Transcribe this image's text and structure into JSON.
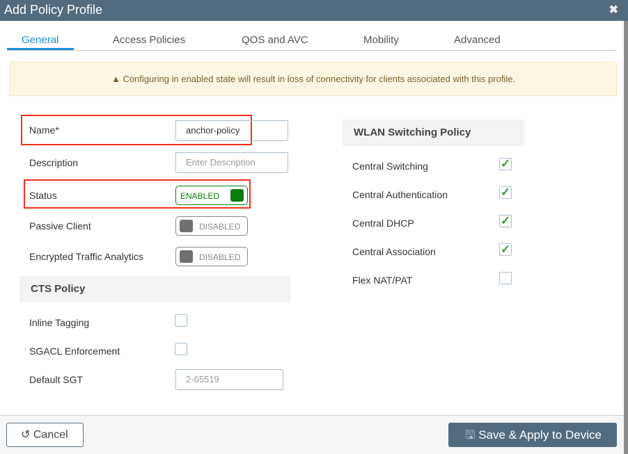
{
  "dialog": {
    "title": "Add Policy Profile",
    "close_icon": "close-icon"
  },
  "tabs": [
    {
      "label": "General",
      "active": true
    },
    {
      "label": "Access Policies"
    },
    {
      "label": "QOS and AVC"
    },
    {
      "label": "Mobility"
    },
    {
      "label": "Advanced"
    }
  ],
  "banner": {
    "icon": "warning-icon",
    "text": "Configuring in enabled state will result in loss of connectivity for clients associated with this profile."
  },
  "form": {
    "name": {
      "label": "Name*",
      "value": "anchor-policy"
    },
    "description": {
      "label": "Description",
      "placeholder": "Enter Description"
    },
    "status": {
      "label": "Status",
      "state": "ENABLED"
    },
    "passive_client": {
      "label": "Passive Client",
      "state": "DISABLED"
    },
    "eta": {
      "label": "Encrypted Traffic Analytics",
      "state": "DISABLED"
    }
  },
  "cts": {
    "title": "CTS Policy",
    "inline_tagging": {
      "label": "Inline Tagging",
      "checked": false
    },
    "sgacl": {
      "label": "SGACL Enforcement",
      "checked": false
    },
    "default_sgt": {
      "label": "Default SGT",
      "placeholder": "2-65519"
    }
  },
  "wlan": {
    "title": "WLAN Switching Policy",
    "items": [
      {
        "label": "Central Switching",
        "checked": true
      },
      {
        "label": "Central Authentication",
        "checked": true
      },
      {
        "label": "Central DHCP",
        "checked": true
      },
      {
        "label": "Central Association",
        "checked": true
      },
      {
        "label": "Flex NAT/PAT",
        "checked": false
      }
    ]
  },
  "footer": {
    "cancel": "Cancel",
    "save": "Save & Apply to Device"
  },
  "colors": {
    "header": "#526b7f",
    "enabled": "#0a7d0a",
    "highlight": "#f2301c",
    "accent": "#1a8fd6"
  }
}
